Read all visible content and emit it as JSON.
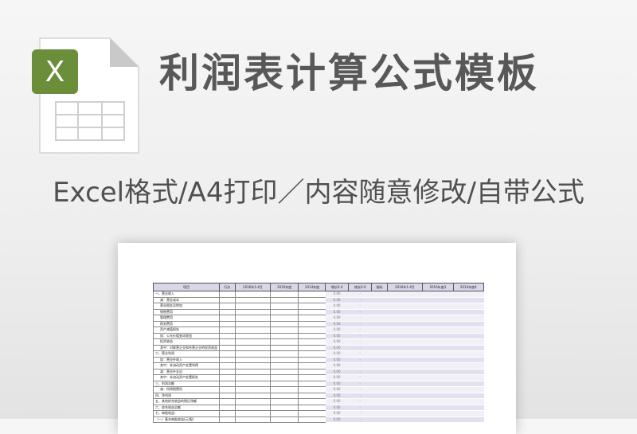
{
  "header": {
    "title": "利润表计算公式模板",
    "subtitle": "Excel格式/A4打印／内容随意修改/自带公式",
    "icon_letter": "X"
  },
  "colors": {
    "icon_green": "#6b8e3a",
    "page_bg": "#f0f0f0"
  },
  "sheet": {
    "left_headers": [
      "项目",
      "行次",
      "2016年1-4月",
      "2016年度",
      "2014年度"
    ],
    "right_headers": [
      "增长0-4",
      "增长0-0",
      "指标",
      "2016年1-4月",
      "2016年度3",
      "2014年度4"
    ],
    "rows": [
      "一、营业收入",
      "减：营业成本",
      "营业税金及附加",
      "销售费用",
      "管理费用",
      "财务费用",
      "资产减值损失",
      "加：公允价值变动收益",
      "投资收益",
      "其中：对联营企业和合营企业的投资收益",
      "二、营业利润",
      "加：营业外收入",
      "其中：非流动资产处置利得",
      "减：营业外支出",
      "其中：非流动资产处置损失",
      "三、利润总额",
      "减：所得税费用",
      "四、净利润",
      "五、其他综合收益的税后净额",
      "六、综合收益总额",
      "七、每股收益：",
      "（一）基本每股收益(元/股)"
    ],
    "zero_value": "0.00",
    "dash_value": "-"
  }
}
